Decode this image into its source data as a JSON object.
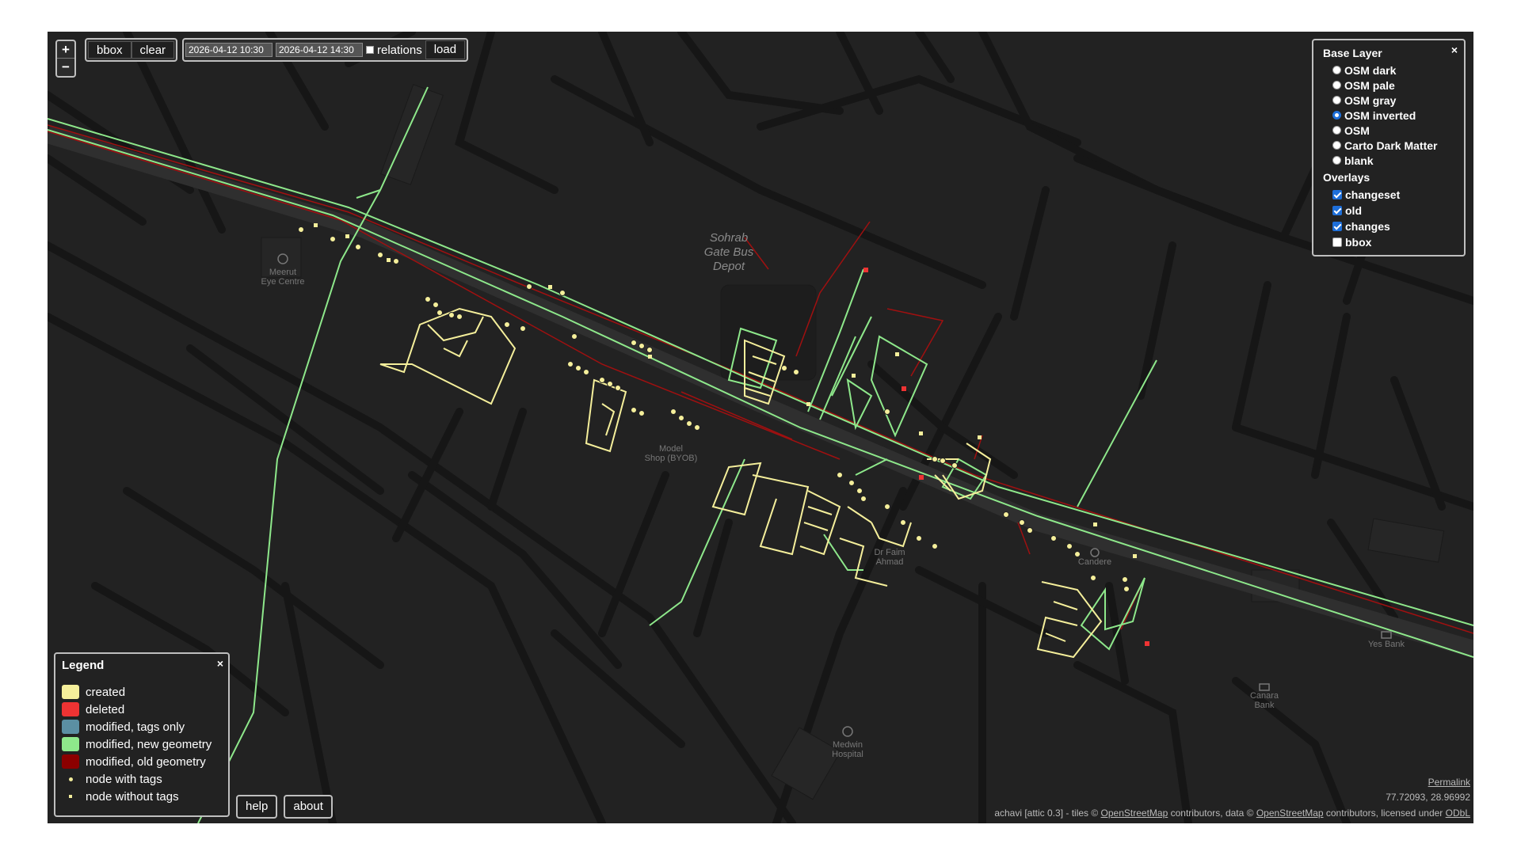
{
  "controls": {
    "zoom_in": "+",
    "zoom_out": "−",
    "bbox_label": "bbox",
    "clear_label": "clear",
    "time_from": "2026-04-12 10:30",
    "time_to": "2026-04-12 14:30",
    "relations_label": "relations",
    "load_label": "load"
  },
  "layers": {
    "title": "Base Layer",
    "close": "×",
    "base": [
      {
        "label": "OSM dark",
        "selected": false
      },
      {
        "label": "OSM pale",
        "selected": false
      },
      {
        "label": "OSM gray",
        "selected": false
      },
      {
        "label": "OSM inverted",
        "selected": true
      },
      {
        "label": "OSM",
        "selected": false
      },
      {
        "label": "Carto Dark Matter",
        "selected": false
      },
      {
        "label": "blank",
        "selected": false
      }
    ],
    "overlays_title": "Overlays",
    "overlays": [
      {
        "label": "changeset",
        "checked": true
      },
      {
        "label": "old",
        "checked": true
      },
      {
        "label": "changes",
        "checked": true
      },
      {
        "label": "bbox",
        "checked": false
      }
    ]
  },
  "legend": {
    "title": "Legend",
    "close": "×",
    "items": [
      {
        "label": "created",
        "color": "#f5ef9b"
      },
      {
        "label": "deleted",
        "color": "#ee3333"
      },
      {
        "label": "modified, tags only",
        "color": "#5b8fa3"
      },
      {
        "label": "modified, new geometry",
        "color": "#8ee88b"
      },
      {
        "label": "modified, old geometry",
        "color": "#8b0000"
      },
      {
        "label": "node with tags",
        "color": "#f5ef9b"
      },
      {
        "label": "node without tags",
        "color": "#f5ef9b"
      }
    ]
  },
  "bottom": {
    "help_label": "help",
    "about_label": "about",
    "permalink": "Permalink",
    "coords": "77.72093, 28.96992",
    "attribution_prefix": "achavi [attic 0.3]  -  tiles © ",
    "osm_link_1": "OpenStreetMap",
    "attribution_mid": " contributors, data © ",
    "osm_link_2": "OpenStreetMap",
    "attribution_suffix": " contributors, licensed under ",
    "odbl_link": "ODbL"
  },
  "map_labels": {
    "bus_depot": [
      "Sohrab",
      "Gate Bus",
      "Depot"
    ],
    "eye_centre": [
      "Meerut",
      "Eye Centre"
    ],
    "model_shop": [
      "Model",
      "Shop (BYOB)"
    ],
    "dr_faiz": [
      "Dr Faim",
      "Ahmad"
    ],
    "candere": "Candere",
    "yes_bank": "Yes Bank",
    "canara_bank": [
      "Canara",
      "Bank"
    ],
    "medwin": [
      "Medwin",
      "Hospital"
    ]
  },
  "colors": {
    "created": "#f5ef9b",
    "deleted": "#ee3333",
    "new_geometry": "#8ee88b",
    "old_geometry": "#a01010",
    "selected_radio": "#1e6fd9"
  }
}
